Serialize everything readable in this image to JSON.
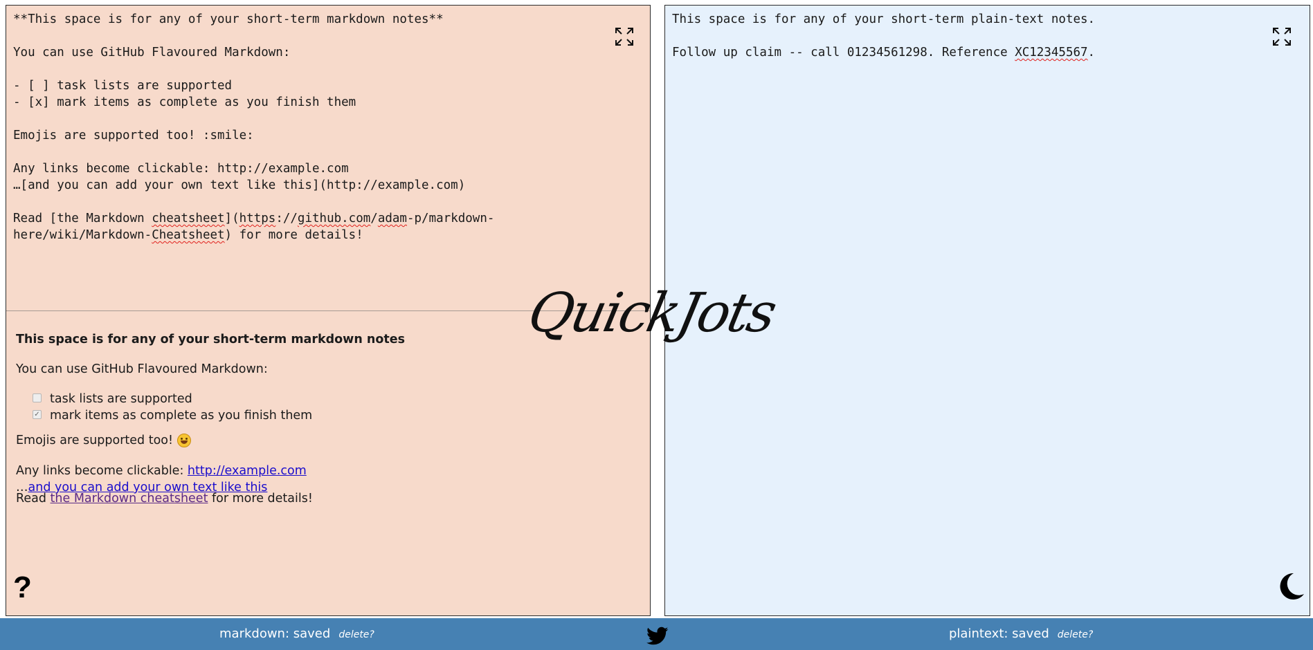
{
  "logo": {
    "text": "QuickJots"
  },
  "markdown_panel": {
    "editor_lines": [
      [
        {
          "t": "**This space is for any of your short-term markdown notes**"
        }
      ],
      [],
      [
        {
          "t": "You can use GitHub Flavoured Markdown:"
        }
      ],
      [],
      [
        {
          "t": "- [ ] task lists are supported"
        }
      ],
      [
        {
          "t": "- [x] mark items as complete as you finish them"
        }
      ],
      [],
      [
        {
          "t": "Emojis are supported too! :smile:"
        }
      ],
      [],
      [
        {
          "t": "Any links become clickable: http://example.com"
        }
      ],
      [
        {
          "t": "…[and you can add your own text like this](http://example.com)"
        }
      ],
      [],
      [
        {
          "t": "Read [the Markdown "
        },
        {
          "t": "cheatsheet",
          "s": true
        },
        {
          "t": "]("
        },
        {
          "t": "https",
          "s": true
        },
        {
          "t": "://"
        },
        {
          "t": "github.com",
          "s": true
        },
        {
          "t": "/"
        },
        {
          "t": "adam",
          "s": true
        },
        {
          "t": "-p/markdown-"
        }
      ],
      [
        {
          "t": "here/wiki/Markdown-"
        },
        {
          "t": "Cheatsheet",
          "s": true
        },
        {
          "t": ") for more details!"
        }
      ]
    ],
    "preview": {
      "title": "This space is for any of your short-term markdown notes",
      "intro": "You can use GitHub Flavoured Markdown:",
      "tasks": [
        {
          "label": "task lists are supported",
          "checked": false
        },
        {
          "label": "mark items as complete as you finish them",
          "checked": true
        }
      ],
      "emoji_text": "Emojis are supported too!",
      "emoji_name": "smile",
      "links_prefix": "Any links become clickable: ",
      "link_url_text": "http://example.com",
      "ellipsis": "…",
      "link_custom_text": "and you can add your own text like this",
      "read_prefix": "Read ",
      "read_link_text": "the Markdown cheatsheet",
      "read_suffix": " for more details!"
    },
    "expand_icon": "expand-icon",
    "help_icon": "?"
  },
  "plaintext_panel": {
    "editor_lines": [
      [
        {
          "t": "This space is for any of your short-term plain-text notes."
        }
      ],
      [],
      [
        {
          "t": "Follow up claim -- call 01234561298. Reference "
        },
        {
          "t": "XC12345567",
          "s": true
        },
        {
          "t": "."
        }
      ]
    ],
    "expand_icon": "expand-icon",
    "theme_icon": "moon-icon"
  },
  "footer": {
    "markdown_status": "markdown: saved",
    "markdown_delete": "delete?",
    "plaintext_status": "plaintext: saved",
    "plaintext_delete": "delete?",
    "social_icon": "twitter-icon"
  },
  "colors": {
    "markdown_bg": "#f7dacb",
    "plaintext_bg": "#e6f1fc",
    "footer_bg": "#4681b3",
    "link": "#1a0dcc",
    "visited_link": "#5b2a86"
  }
}
